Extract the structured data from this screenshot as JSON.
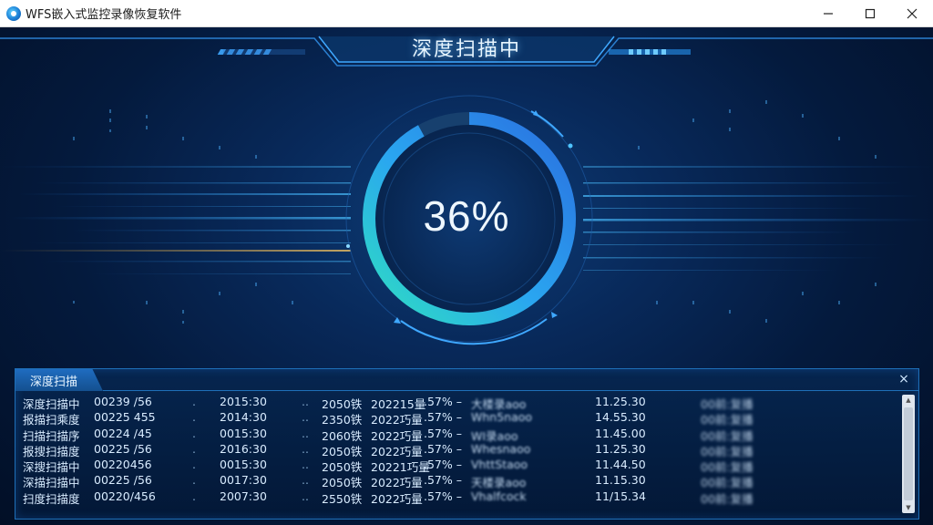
{
  "window": {
    "title": "WFS嵌入式监控录像恢复软件",
    "icon": "app-logo-icon"
  },
  "banner": {
    "title": "深度扫描中"
  },
  "progress": {
    "percent_label": "36%",
    "value": 0.36
  },
  "panel": {
    "tab_label": "深度扫描",
    "close_label": "×",
    "rows": [
      {
        "name": "深度扫描中",
        "code": "00239 /56",
        "dot1": ".",
        "time1": "2015:30",
        "dot2": "..",
        "size": "2050铁",
        "date": "202215量",
        "pct": ".57% –",
        "file": "大楼录aoo",
        "time2": "11.25.30",
        "status": "00前:复播"
      },
      {
        "name": "报描扫乘度",
        "code": "00225 455",
        "dot1": ".",
        "time1": "2014:30",
        "dot2": "..",
        "size": "2350铁",
        "date": "2022巧量",
        "pct": ".57% –",
        "file": "Whn5naoo",
        "time2": "14.55.30",
        "status": "00前:复播"
      },
      {
        "name": "扫描扫描序",
        "code": "00224 /45",
        "dot1": ".",
        "time1": "0015:30",
        "dot2": "..",
        "size": "2060铁",
        "date": "2022巧量",
        "pct": ".57% –",
        "file": "WI录aoo",
        "time2": "11.45.00",
        "status": "00前:复播"
      },
      {
        "name": "报搜扫描度",
        "code": "00225 /56",
        "dot1": ".",
        "time1": "2016:30",
        "dot2": "..",
        "size": "2050铁",
        "date": "2022巧量",
        "pct": ".57% –",
        "file": "Whesnaoo",
        "time2": "11.25.30",
        "status": "00前:复播"
      },
      {
        "name": "深搜扫描中",
        "code": "00220456",
        "dot1": ".",
        "time1": "0015:30",
        "dot2": "..",
        "size": "2050铁",
        "date": "20221巧量",
        "pct": ".57% –",
        "file": "VhttStaoo",
        "time2": "11.44.50",
        "status": "00前:复播"
      },
      {
        "name": "深描扫描中",
        "code": "00225 /56",
        "dot1": ".",
        "time1": "0017:30",
        "dot2": "..",
        "size": "2050铁",
        "date": "2022巧量",
        "pct": ".57% –",
        "file": "天楼录aoo",
        "time2": "11.15.30",
        "status": "00前:复播"
      },
      {
        "name": "扫度扫描度",
        "code": "00220/456",
        "dot1": ".",
        "time1": "2007:30",
        "dot2": "..",
        "size": "2550铁",
        "date": "2022巧量",
        "pct": ".57% –",
        "file": "Vhalfcock",
        "time2": "11/15.34",
        "status": "00前:复播"
      }
    ]
  },
  "colors": {
    "ring_start": "#2fe0c0",
    "ring_end": "#2a7fe8",
    "accent": "#2e9cff"
  }
}
